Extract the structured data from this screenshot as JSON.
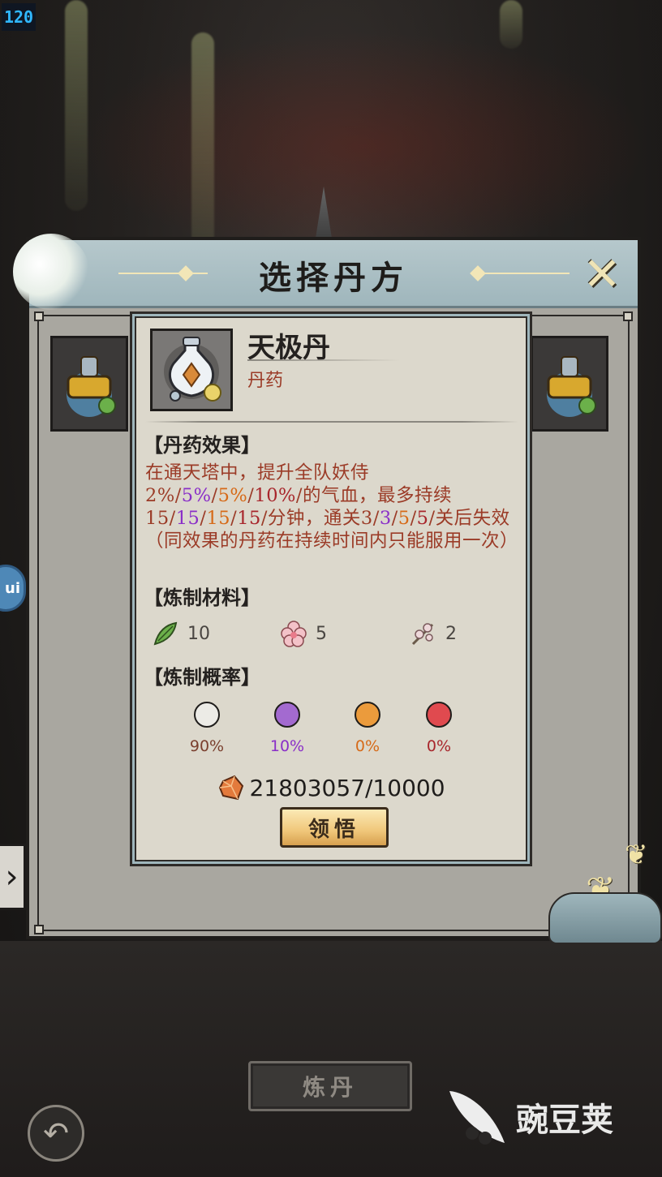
{
  "status": {
    "fps": "120"
  },
  "dialog": {
    "title": "选择丹方",
    "close_label": "✕"
  },
  "detail": {
    "name": "天极丹",
    "type": "丹药",
    "effect_heading": "【丹药效果】",
    "effect_segments": [
      {
        "text": "在通天塔中，提升全队妖侍2%/",
        "tone": "base"
      },
      {
        "text": "5%",
        "tone": "purple"
      },
      {
        "text": "/",
        "tone": "base"
      },
      {
        "text": "5%",
        "tone": "orange"
      },
      {
        "text": "/",
        "tone": "base"
      },
      {
        "text": "10%",
        "tone": "red"
      },
      {
        "text": "/的气血，最多持续15/",
        "tone": "base"
      },
      {
        "text": "15",
        "tone": "purple"
      },
      {
        "text": "/",
        "tone": "base"
      },
      {
        "text": "15",
        "tone": "orange"
      },
      {
        "text": "/",
        "tone": "base"
      },
      {
        "text": "15",
        "tone": "red"
      },
      {
        "text": "/分钟，通关3/",
        "tone": "base"
      },
      {
        "text": "3",
        "tone": "purple"
      },
      {
        "text": "/",
        "tone": "base"
      },
      {
        "text": "5",
        "tone": "orange"
      },
      {
        "text": "/",
        "tone": "base"
      },
      {
        "text": "5",
        "tone": "red"
      },
      {
        "text": "/关后失效（同效果的丹药在持续时间内只能服用一次）",
        "tone": "base"
      }
    ],
    "materials_heading": "【炼制材料】",
    "materials": [
      {
        "icon": "leaf-icon",
        "count": "10"
      },
      {
        "icon": "blossom-icon",
        "count": "5"
      },
      {
        "icon": "branch-flower-icon",
        "count": "2"
      }
    ],
    "probability_heading": "【炼制概率】",
    "probabilities": [
      {
        "color": "#ecebe6",
        "text_color": "#7a3f2e",
        "value": "90%"
      },
      {
        "color": "#a36ad0",
        "text_color": "#8a2fc8",
        "value": "10%"
      },
      {
        "color": "#eb9b3c",
        "text_color": "#d66a18",
        "value": "0%"
      },
      {
        "color": "#e04a4f",
        "text_color": "#a8262c",
        "value": "0%"
      }
    ],
    "cost": "21803057/10000",
    "comprehend_label": "领悟"
  },
  "footer": {
    "alchemy_label": "炼丹",
    "watermark_text": "豌豆荚"
  },
  "colors": {
    "tone_base": "#9b3b27",
    "tone_purple": "#8a2fc8",
    "tone_orange": "#d66a18",
    "tone_red": "#a8262c"
  }
}
